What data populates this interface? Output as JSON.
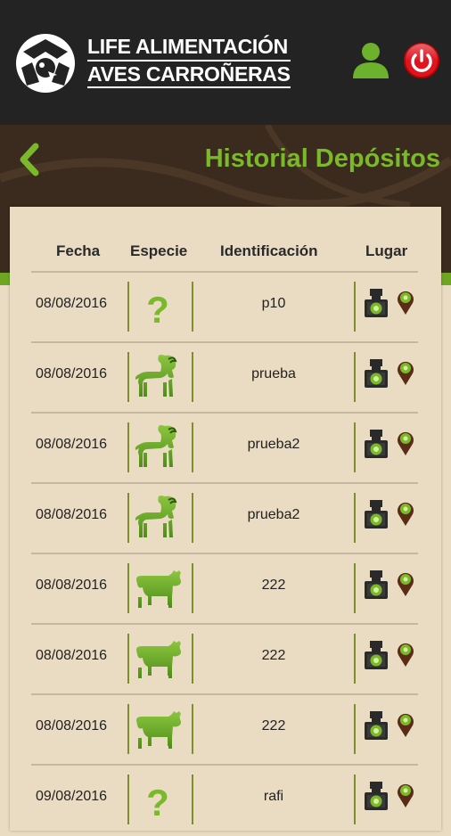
{
  "header": {
    "logo_line1": "LIFE ALIMENTACIÓN",
    "logo_line2": "AVES CARROÑERAS",
    "user_icon": "user-icon",
    "power_icon": "power-icon"
  },
  "page": {
    "title": "Historial Depósitos",
    "back_icon": "chevron-left-icon"
  },
  "table": {
    "columns": [
      "Fecha",
      "Especie",
      "Identificación",
      "Lugar"
    ],
    "rows": [
      {
        "date": "08/08/2016",
        "species": "unknown",
        "id": "p10"
      },
      {
        "date": "08/08/2016",
        "species": "goat",
        "id": "prueba"
      },
      {
        "date": "08/08/2016",
        "species": "goat",
        "id": "prueba2"
      },
      {
        "date": "08/08/2016",
        "species": "goat",
        "id": "prueba2"
      },
      {
        "date": "08/08/2016",
        "species": "cow",
        "id": "222"
      },
      {
        "date": "08/08/2016",
        "species": "cow",
        "id": "222"
      },
      {
        "date": "08/08/2016",
        "species": "cow",
        "id": "222"
      },
      {
        "date": "09/08/2016",
        "species": "unknown",
        "id": "rafi"
      }
    ]
  },
  "colors": {
    "accent_green": "#7ab929",
    "header_bg": "#232323",
    "banner_bg": "#3b2a1e",
    "card_bg": "#e9dcc2",
    "power_red": "#e0141e"
  }
}
